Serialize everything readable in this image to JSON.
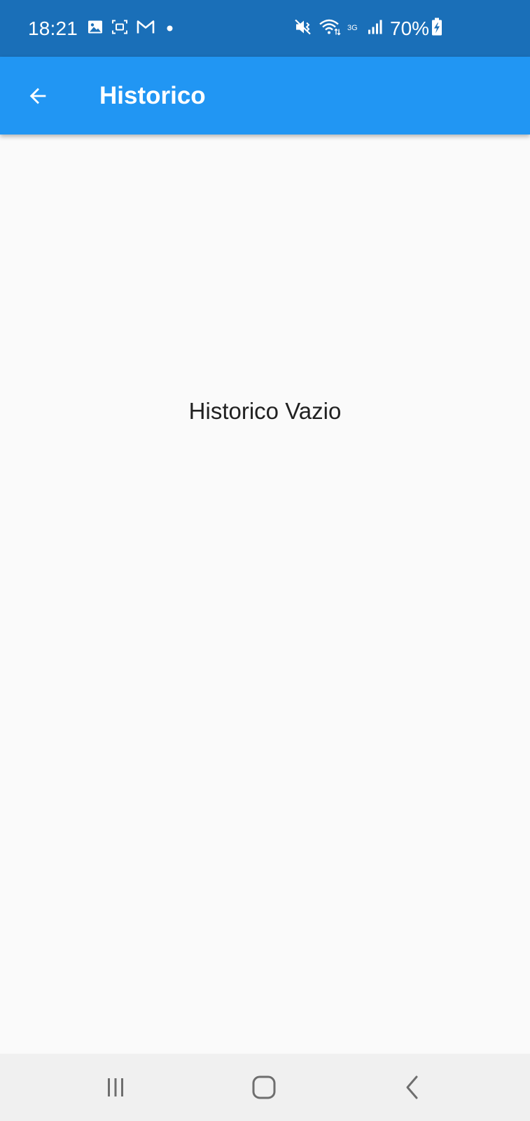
{
  "status_bar": {
    "time": "18:21",
    "battery": "70%",
    "network_type": "3G",
    "icons": [
      "image-icon",
      "screen-record-icon",
      "gmail-icon",
      "dot-icon",
      "mute-vibrate-icon",
      "wifi-icon",
      "signal-icon",
      "battery-charging-icon"
    ]
  },
  "app_bar": {
    "title": "Historico",
    "back_icon": "arrow-back-icon",
    "color": "#2196f3"
  },
  "content": {
    "empty_message": "Historico Vazio"
  },
  "nav_bar": {
    "icons": [
      "recent-apps-icon",
      "home-icon",
      "back-icon"
    ]
  },
  "colors": {
    "status_bar": "#1a6fb8",
    "app_bar": "#2196f3",
    "background": "#fafafa",
    "nav_bar": "#f0f0f0"
  }
}
